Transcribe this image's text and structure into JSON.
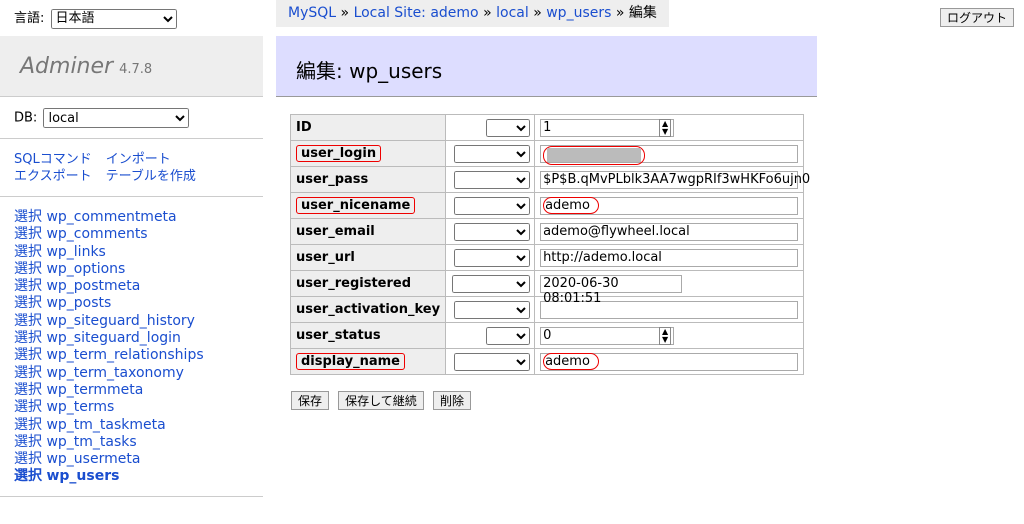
{
  "lang": {
    "label": "言語:",
    "value": "日本語"
  },
  "brand": {
    "name": "Adminer",
    "version": "4.7.8"
  },
  "db": {
    "label": "DB:",
    "value": "local"
  },
  "links": [
    "SQLコマンド",
    "インポート",
    "エクスポート",
    "テーブルを作成"
  ],
  "select_label": "選択",
  "tables": [
    "wp_commentmeta",
    "wp_comments",
    "wp_links",
    "wp_options",
    "wp_postmeta",
    "wp_posts",
    "wp_siteguard_history",
    "wp_siteguard_login",
    "wp_term_relationships",
    "wp_term_taxonomy",
    "wp_termmeta",
    "wp_terms",
    "wp_tm_taskmeta",
    "wp_tm_tasks",
    "wp_usermeta",
    "wp_users"
  ],
  "breadcrumb": {
    "server": "MySQL",
    "site": "Local Site: ademo",
    "db": "local",
    "table": "wp_users",
    "current": "編集",
    "sep": "»"
  },
  "logout": "ログアウト",
  "page_title": "編集: wp_users",
  "fields": [
    {
      "name": "ID",
      "value": "1",
      "type": "number"
    },
    {
      "name": "user_login",
      "value": "",
      "type": "blurred",
      "highlighted": true
    },
    {
      "name": "user_pass",
      "value": "$P$B.qMvPLblk3AA7wgpRIf3wHKFo6ujn0",
      "type": "text"
    },
    {
      "name": "user_nicename",
      "value": "ademo",
      "type": "text",
      "highlighted": true
    },
    {
      "name": "user_email",
      "value": "ademo@flywheel.local",
      "type": "text"
    },
    {
      "name": "user_url",
      "value": "http://ademo.local",
      "type": "text"
    },
    {
      "name": "user_registered",
      "value": "2020-06-30 08:01:51",
      "type": "date"
    },
    {
      "name": "user_activation_key",
      "value": "",
      "type": "text"
    },
    {
      "name": "user_status",
      "value": "0",
      "type": "number"
    },
    {
      "name": "display_name",
      "value": "ademo",
      "type": "text",
      "highlighted": true
    }
  ],
  "buttons": {
    "save": "保存",
    "save_continue": "保存して継続",
    "delete": "削除"
  },
  "colors": {
    "link": "#1a4ecf",
    "title_bg": "#ddff",
    "highlight": "#e00000"
  }
}
